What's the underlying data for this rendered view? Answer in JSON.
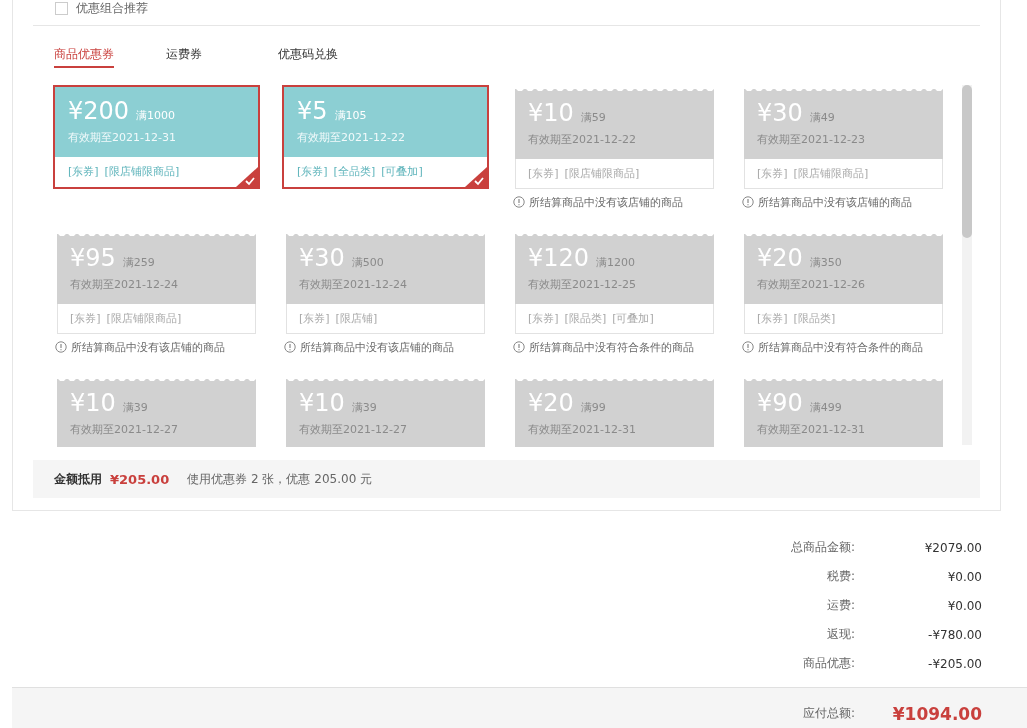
{
  "combo": {
    "label": "优惠组合推荐",
    "checked": false
  },
  "tabs": [
    {
      "label": "商品优惠券",
      "selected": true
    },
    {
      "label": "运费券",
      "selected": false
    },
    {
      "label": "优惠码兑换",
      "selected": false
    }
  ],
  "coupons": [
    {
      "amount": "¥200",
      "condition": "满1000",
      "expiry": "有效期至2021-12-31",
      "tags": [
        "[东券]",
        "[限店铺限商品]"
      ],
      "selected": true,
      "kind": "available"
    },
    {
      "amount": "¥5",
      "condition": "满105",
      "expiry": "有效期至2021-12-22",
      "tags": [
        "[东券]",
        "[全品类]",
        "[可叠加]"
      ],
      "selected": true,
      "kind": "available"
    },
    {
      "amount": "¥10",
      "condition": "满59",
      "expiry": "有效期至2021-12-22",
      "tags": [
        "[东券]",
        "[限店铺限商品]"
      ],
      "selected": false,
      "kind": "unavailable",
      "warning": "所结算商品中没有该店铺的商品"
    },
    {
      "amount": "¥30",
      "condition": "满49",
      "expiry": "有效期至2021-12-23",
      "tags": [
        "[东券]",
        "[限店铺限商品]"
      ],
      "selected": false,
      "kind": "unavailable",
      "warning": "所结算商品中没有该店铺的商品"
    },
    {
      "amount": "¥95",
      "condition": "满259",
      "expiry": "有效期至2021-12-24",
      "tags": [
        "[东券]",
        "[限店铺限商品]"
      ],
      "selected": false,
      "kind": "unavailable",
      "warning": "所结算商品中没有该店铺的商品"
    },
    {
      "amount": "¥30",
      "condition": "满500",
      "expiry": "有效期至2021-12-24",
      "tags": [
        "[东券]",
        "[限店铺]"
      ],
      "selected": false,
      "kind": "unavailable",
      "warning": "所结算商品中没有该店铺的商品"
    },
    {
      "amount": "¥120",
      "condition": "满1200",
      "expiry": "有效期至2021-12-25",
      "tags": [
        "[东券]",
        "[限品类]",
        "[可叠加]"
      ],
      "selected": false,
      "kind": "unavailable",
      "warning": "所结算商品中没有符合条件的商品"
    },
    {
      "amount": "¥20",
      "condition": "满350",
      "expiry": "有效期至2021-12-26",
      "tags": [
        "[东券]",
        "[限品类]"
      ],
      "selected": false,
      "kind": "unavailable",
      "warning": "所结算商品中没有符合条件的商品"
    },
    {
      "amount": "¥10",
      "condition": "满39",
      "expiry": "有效期至2021-12-27",
      "selected": false,
      "kind": "unavailable"
    },
    {
      "amount": "¥10",
      "condition": "满39",
      "expiry": "有效期至2021-12-27",
      "selected": false,
      "kind": "unavailable"
    },
    {
      "amount": "¥20",
      "condition": "满99",
      "expiry": "有效期至2021-12-31",
      "selected": false,
      "kind": "unavailable"
    },
    {
      "amount": "¥90",
      "condition": "满499",
      "expiry": "有效期至2021-12-31",
      "selected": false,
      "kind": "unavailable"
    }
  ],
  "discount_bar": {
    "label": "金额抵用",
    "amount": "¥205.00",
    "note": "使用优惠券 2 张，优惠 205.00 元"
  },
  "summary": [
    {
      "label": "总商品金额:",
      "value": "¥2079.00"
    },
    {
      "label": "税费:",
      "value": "¥0.00"
    },
    {
      "label": "运费:",
      "value": "¥0.00"
    },
    {
      "label": "返现:",
      "value": "-¥780.00"
    },
    {
      "label": "商品优惠:",
      "value": "-¥205.00"
    }
  ],
  "total": {
    "label": "应付总额:",
    "value": "¥1094.00"
  }
}
